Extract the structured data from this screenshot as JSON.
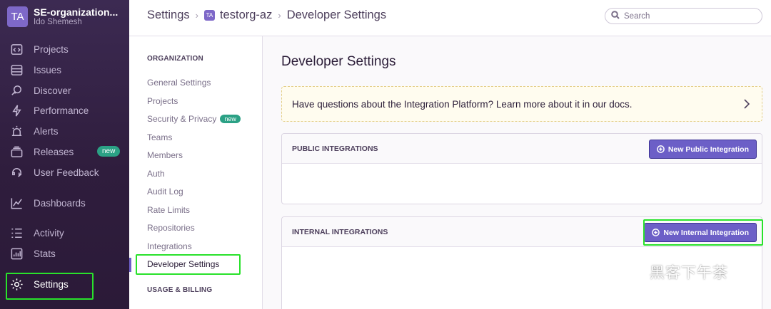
{
  "org": {
    "avatar": "TA",
    "name": "SE-organization...",
    "user": "Ido Shemesh"
  },
  "sidebar": {
    "items": [
      {
        "label": "Projects",
        "icon": "projects-icon"
      },
      {
        "label": "Issues",
        "icon": "issues-icon"
      },
      {
        "label": "Discover",
        "icon": "discover-icon"
      },
      {
        "label": "Performance",
        "icon": "performance-icon"
      },
      {
        "label": "Alerts",
        "icon": "alerts-icon"
      },
      {
        "label": "Releases",
        "icon": "releases-icon",
        "badge": "new"
      },
      {
        "label": "User Feedback",
        "icon": "user-feedback-icon"
      },
      {
        "label": "Dashboards",
        "icon": "dashboards-icon"
      },
      {
        "label": "Activity",
        "icon": "activity-icon"
      },
      {
        "label": "Stats",
        "icon": "stats-icon"
      },
      {
        "label": "Settings",
        "icon": "settings-icon"
      }
    ]
  },
  "breadcrumb": {
    "root": "Settings",
    "org_avatar": "TA",
    "org": "testorg-az",
    "current": "Developer Settings"
  },
  "search": {
    "placeholder": "Search"
  },
  "subnav": {
    "section_org": "ORGANIZATION",
    "items": [
      {
        "label": "General Settings"
      },
      {
        "label": "Projects"
      },
      {
        "label": "Security & Privacy",
        "badge": "new"
      },
      {
        "label": "Teams"
      },
      {
        "label": "Members"
      },
      {
        "label": "Auth"
      },
      {
        "label": "Audit Log"
      },
      {
        "label": "Rate Limits"
      },
      {
        "label": "Repositories"
      },
      {
        "label": "Integrations"
      },
      {
        "label": "Developer Settings",
        "active": true
      }
    ],
    "section_billing": "USAGE & BILLING"
  },
  "main": {
    "title": "Developer Settings",
    "alert": "Have questions about the Integration Platform? Learn more about it in our docs.",
    "public": {
      "header": "PUBLIC INTEGRATIONS",
      "button": "New Public Integration"
    },
    "internal": {
      "header": "INTERNAL INTEGRATIONS",
      "button": "New Internal Integration"
    }
  },
  "watermark": {
    "text": "黑客下午茶"
  },
  "colors": {
    "accent": "#6c5fc7",
    "sidebar_bg": "#2f1d3d",
    "highlight": "#29e22b",
    "badge_new": "#2ba185"
  }
}
